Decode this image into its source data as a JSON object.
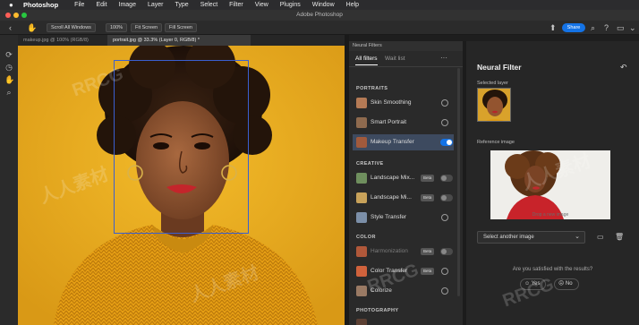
{
  "menubar": {
    "app_name": "Photoshop",
    "items": [
      "File",
      "Edit",
      "Image",
      "Layer",
      "Type",
      "Select",
      "Filter",
      "View",
      "Plugins",
      "Window",
      "Help"
    ]
  },
  "window": {
    "title": "Adobe Photoshop"
  },
  "options_bar": {
    "scroll_all": "Scroll All Windows",
    "zoom": "100%",
    "fit_screen": "Fit Screen",
    "fill_screen": "Fill Screen",
    "share": "Share"
  },
  "documents": {
    "tabs": [
      {
        "label": "makeup.jpg @ 100% (RGB/8)"
      },
      {
        "label": "portrait.jpg @ 33.3% (Layer 0, RGB/8) *"
      }
    ]
  },
  "neural_filters": {
    "panel_header": "Neural Filters",
    "tabs": [
      {
        "label": "All filters"
      },
      {
        "label": "Wait list"
      }
    ],
    "more": "···",
    "categories": [
      {
        "label": "PORTRAITS",
        "filters": [
          {
            "name": "Skin Smoothing",
            "beta": "",
            "state": "radio",
            "dim": false,
            "thumb": "#b47a55"
          },
          {
            "name": "Smart Portrait",
            "beta": "",
            "state": "radio",
            "dim": false,
            "thumb": "#8e6a4e"
          },
          {
            "name": "Makeup Transfer",
            "beta": "",
            "state": "on",
            "dim": false,
            "thumb": "#a15a3c"
          }
        ]
      },
      {
        "label": "CREATIVE",
        "filters": [
          {
            "name": "Landscape Mix...",
            "beta": "Beta",
            "state": "off",
            "dim": false,
            "thumb": "#6f8f5e"
          },
          {
            "name": "Landscape Mi...",
            "beta": "Beta",
            "state": "off",
            "dim": false,
            "thumb": "#c8a25a"
          },
          {
            "name": "Style Transfer",
            "beta": "",
            "state": "radio",
            "dim": false,
            "thumb": "#7c8fa8"
          }
        ]
      },
      {
        "label": "COLOR",
        "filters": [
          {
            "name": "Harmonization",
            "beta": "Beta",
            "state": "off",
            "dim": true,
            "thumb": "#b0583a"
          },
          {
            "name": "Color Transfer",
            "beta": "Beta",
            "state": "radio",
            "dim": false,
            "thumb": "#d0623c"
          },
          {
            "name": "Colorize",
            "beta": "",
            "state": "radio",
            "dim": false,
            "thumb": "#9a7a64"
          }
        ]
      },
      {
        "label": "PHOTOGRAPHY",
        "filters": []
      }
    ]
  },
  "detail": {
    "title": "Neural Filter",
    "selected_layer_label": "Selected layer",
    "reference_label": "Reference image",
    "reference_hint": "Drop a new image",
    "select_image": "Select another image",
    "feedback_question": "Are you satisfied with the results?",
    "yes": "Yes",
    "no": "No"
  },
  "watermarks": [
    "人人素材",
    "RRCG",
    "人人素材",
    "RRCG",
    "RRCG",
    "人人素材"
  ],
  "colors": {
    "accent": "#1473e6",
    "canvas_bg": "#e7a91f",
    "face_box": "#3a5fd0"
  },
  "icons": {
    "toolbar": [
      "rotate-icon",
      "history-icon",
      "hand-icon",
      "zoom-icon"
    ],
    "options": [
      "back-icon",
      "hand-icon",
      "share-icon",
      "search-icon",
      "help-icon",
      "layout-icon",
      "more-icon"
    ]
  }
}
